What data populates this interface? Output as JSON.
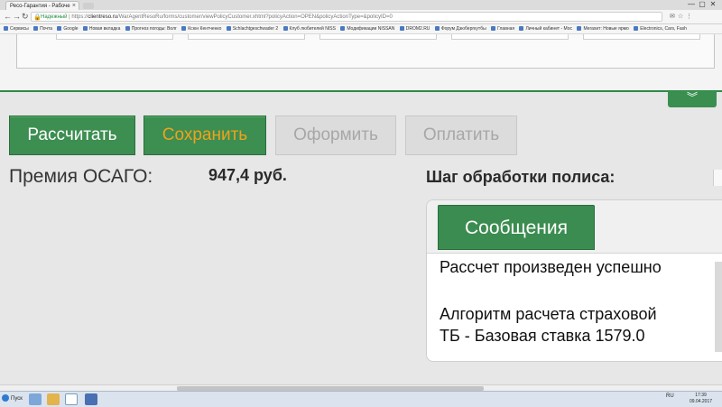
{
  "browser": {
    "tab_title": "Ресо-Гарантия - Рабоче",
    "tab_close": "×",
    "window_controls": [
      "—",
      "▢",
      "✕"
    ],
    "secure_label": "Надежный",
    "url_prefix": "https://",
    "url_host": "clientreso.ru",
    "url_path": "/WarAgentResoRu/forms/customer/viewPolicyCustomer.xhtml?policyAction=OPEN&policyActionType=&policyID=0",
    "bookmarks": [
      "Сервисы",
      "Почта",
      "Google",
      "Новая вкладка",
      "Прогноз погоды: Волг",
      "Ксюн Кентченко",
      "Schlachtgeschwader 2",
      "Клуб любителей NISS",
      "Модификации NISSAN",
      "DROM2.RU",
      "Форум Дзюбергкутбы",
      "Главная",
      "Личный кабинет - Мос",
      "Мегахит: Новые ярмо",
      "Electronics, Cars, Fash"
    ]
  },
  "toolbar": {
    "calculate_label": "Рассчитать",
    "save_label": "Сохранить",
    "issue_label": "Оформить",
    "pay_label": "Оплатить",
    "collapse_icon": "chevron-down-icon"
  },
  "premium": {
    "label": "Премия ОСАГО:",
    "value": "947,4 руб."
  },
  "policy_step": {
    "label": "Шаг обработки полиса:"
  },
  "messages": {
    "tab_label": "Сообщения",
    "lines": [
      "Рассчет произведен успешно",
      "Алгоритм расчета страховой",
      "ТБ - Базовая ставка 1579.0"
    ]
  },
  "taskbar": {
    "start_label": "Пуск",
    "lang": "RU",
    "time": "17:39",
    "date": "09.04.2017"
  },
  "colors": {
    "accent_green": "#3d8e51",
    "save_text": "#f0a21c",
    "disabled_text": "#a7a7a7"
  }
}
